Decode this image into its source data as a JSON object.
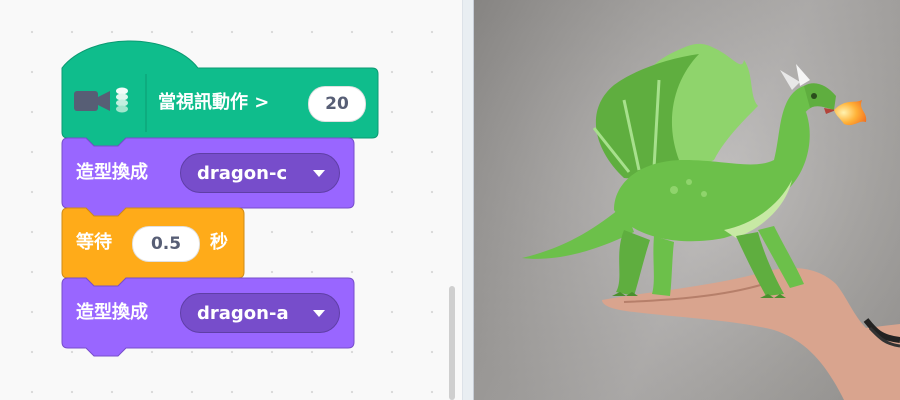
{
  "colors": {
    "video_sensing": "#0fbd8c",
    "looks": "#9966ff",
    "control": "#ffab19",
    "input_text": "#575e75",
    "dragon_green": "#6cc04a"
  },
  "blocks": {
    "hat": {
      "extension_icon": "video-camera-icon",
      "label": "當視訊動作 >",
      "value": "20"
    },
    "switch_costume_1": {
      "label": "造型換成",
      "costume": "dragon-c"
    },
    "wait": {
      "label": "等待",
      "seconds": "0.5",
      "unit": "秒"
    },
    "switch_costume_2": {
      "label": "造型換成",
      "costume": "dragon-a"
    }
  },
  "stage": {
    "sprite": "dragon",
    "background": "webcam video of an open hand"
  }
}
